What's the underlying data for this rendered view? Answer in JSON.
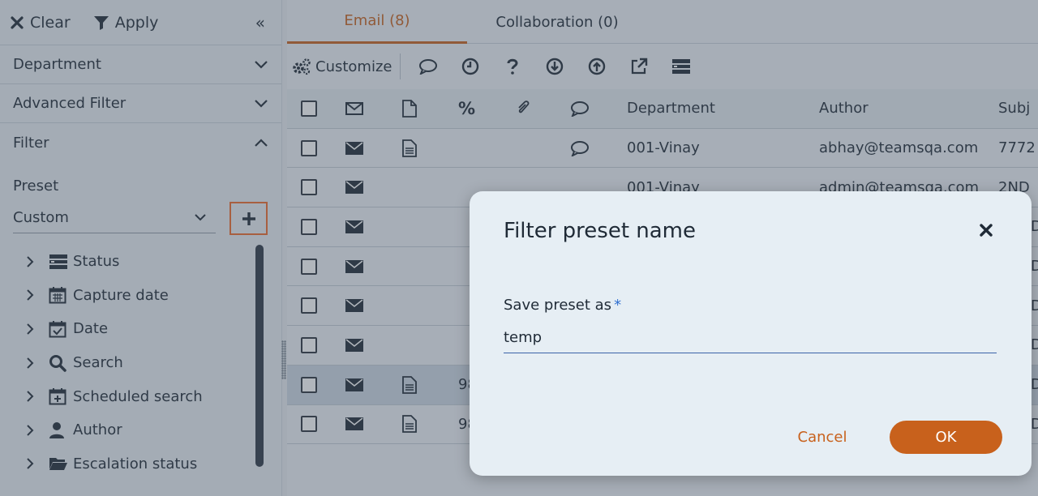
{
  "sidebar": {
    "clear_label": "Clear",
    "apply_label": "Apply",
    "collapse_glyph": "«",
    "sections": {
      "department": "Department",
      "advanced_filter": "Advanced Filter",
      "filter": "Filter"
    },
    "preset_label": "Preset",
    "preset_value": "Custom",
    "tree": [
      {
        "label": "Status",
        "icon": "status-list-icon"
      },
      {
        "label": "Capture date",
        "icon": "calendar-icon"
      },
      {
        "label": "Date",
        "icon": "calendar-check-icon"
      },
      {
        "label": "Search",
        "icon": "search-icon"
      },
      {
        "label": "Scheduled search",
        "icon": "calendar-plus-icon"
      },
      {
        "label": "Author",
        "icon": "user-icon"
      },
      {
        "label": "Escalation status",
        "icon": "folder-open-icon"
      }
    ]
  },
  "tabs": [
    {
      "label": "Email (8)",
      "active": true
    },
    {
      "label": "Collaboration (0)",
      "active": false
    }
  ],
  "toolbar": {
    "customize_label": "Customize",
    "icons": [
      "comment-icon",
      "clock-icon",
      "question-icon",
      "download-icon",
      "upload-icon",
      "external-link-icon",
      "columns-icon"
    ]
  },
  "grid": {
    "headers": {
      "department": "Department",
      "author": "Author",
      "subject": "Subj",
      "percent": "%"
    },
    "rows": [
      {
        "department": "001-Vinay",
        "author": "abhay@teamsqa.com",
        "subject": "7772",
        "doc": true,
        "comment": true,
        "extra": ""
      },
      {
        "department": "001-Vinay",
        "author": "admin@teamsqa.com",
        "subject": "2ND",
        "doc": false,
        "comment": false,
        "extra": ""
      },
      {
        "department": "",
        "author": "",
        "subject": "D",
        "doc": false,
        "comment": false,
        "extra": ""
      },
      {
        "department": "",
        "author": "",
        "subject": "D",
        "doc": false,
        "comment": false,
        "extra": ""
      },
      {
        "department": "",
        "author": "",
        "subject": "D",
        "doc": false,
        "comment": false,
        "extra": ""
      },
      {
        "department": "",
        "author": "",
        "subject": "D",
        "doc": false,
        "comment": false,
        "extra": ""
      },
      {
        "department": "",
        "author": "",
        "subject": "D",
        "doc": true,
        "comment": false,
        "extra": "98",
        "selected": true
      },
      {
        "department": "",
        "author": "",
        "subject": "D",
        "doc": true,
        "comment": false,
        "extra": "98"
      }
    ]
  },
  "dialog": {
    "title": "Filter preset name",
    "field_label": "Save preset as",
    "required_mark": "*",
    "field_value": "temp",
    "cancel_label": "Cancel",
    "ok_label": "OK"
  },
  "colors": {
    "accent": "#c8611c",
    "highlight": "#ef6a2a",
    "required": "#2f6fd0"
  }
}
